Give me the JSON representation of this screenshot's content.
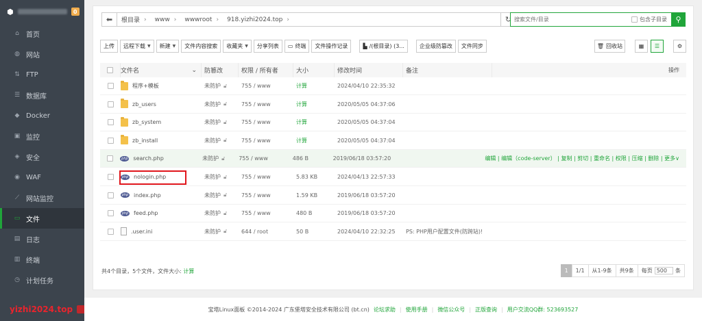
{
  "sidebar": {
    "badge": "0",
    "items": [
      {
        "label": "首页",
        "icon": "home-icon",
        "glyph": "⌂"
      },
      {
        "label": "网站",
        "icon": "globe-icon",
        "glyph": "◍"
      },
      {
        "label": "FTP",
        "icon": "ftp-icon",
        "glyph": "⇅"
      },
      {
        "label": "数据库",
        "icon": "database-icon",
        "glyph": "☰"
      },
      {
        "label": "Docker",
        "icon": "docker-icon",
        "glyph": "◆"
      },
      {
        "label": "监控",
        "icon": "monitor-icon",
        "glyph": "▣"
      },
      {
        "label": "安全",
        "icon": "shield-icon",
        "glyph": "◈"
      },
      {
        "label": "WAF",
        "icon": "waf-icon",
        "glyph": "◉"
      },
      {
        "label": "网站监控",
        "icon": "chart-icon",
        "glyph": "⟋"
      },
      {
        "label": "文件",
        "icon": "folder-icon",
        "glyph": "▭"
      },
      {
        "label": "日志",
        "icon": "log-icon",
        "glyph": "▤"
      },
      {
        "label": "终端",
        "icon": "terminal-icon",
        "glyph": "▥"
      },
      {
        "label": "计划任务",
        "icon": "clock-icon",
        "glyph": "◷"
      }
    ],
    "watermark": "yizhi2024.top"
  },
  "path": {
    "crumbs": [
      "根目录",
      "www",
      "wwwroot",
      "918.yizhi2024.top"
    ]
  },
  "search": {
    "placeholder": "搜索文件/目录",
    "subdir_label": "包含子目录"
  },
  "toolbar": {
    "upload": "上传",
    "remote_download": "远程下载",
    "new": "新建",
    "content_search": "文件内容搜索",
    "favorites": "收藏夹",
    "share_list": "分享列表",
    "terminal": "终端",
    "file_op_log": "文件操作记录",
    "disk": "/(根目录) (3...",
    "enterprise_protect": "企业级防篡改",
    "file_sync": "文件同步",
    "recycle": "回收站"
  },
  "table": {
    "headers": {
      "name": "文件名",
      "protect": "防篡改",
      "perm": "权限 / 所有者",
      "size": "大小",
      "mtime": "修改时间",
      "note": "备注",
      "ops": "操作"
    },
    "rows": [
      {
        "type": "folder",
        "name": "程序+模板",
        "protect": "未防护",
        "perm": "755 / www",
        "size": "计算",
        "mtime": "2024/04/10 22:35:32",
        "note": "",
        "ops": ""
      },
      {
        "type": "folder",
        "name": "zb_users",
        "protect": "未防护",
        "perm": "755 / www",
        "size": "计算",
        "mtime": "2020/05/05 04:37:06",
        "note": "",
        "ops": ""
      },
      {
        "type": "folder",
        "name": "zb_system",
        "protect": "未防护",
        "perm": "755 / www",
        "size": "计算",
        "mtime": "2020/05/05 04:37:04",
        "note": "",
        "ops": ""
      },
      {
        "type": "folder",
        "name": "zb_install",
        "protect": "未防护",
        "perm": "755 / www",
        "size": "计算",
        "mtime": "2020/05/05 04:37:04",
        "note": "",
        "ops": ""
      },
      {
        "type": "php",
        "name": "search.php",
        "protect": "未防护",
        "perm": "755 / www",
        "size": "486 B",
        "mtime": "2019/06/18 03:57:20",
        "note": "",
        "ops": "编辑 | 编辑（code-server） | 复制 | 剪切 | 重命名 | 权限 | 压缩 | 删除 | 更多∨"
      },
      {
        "type": "php",
        "name": "nologin.php",
        "protect": "未防护",
        "perm": "755 / www",
        "size": "5.83 KB",
        "mtime": "2024/04/13 22:57:33",
        "note": "",
        "ops": ""
      },
      {
        "type": "php",
        "name": "index.php",
        "protect": "未防护",
        "perm": "755 / www",
        "size": "1.59 KB",
        "mtime": "2019/06/18 03:57:20",
        "note": "",
        "ops": ""
      },
      {
        "type": "php",
        "name": "feed.php",
        "protect": "未防护",
        "perm": "755 / www",
        "size": "480 B",
        "mtime": "2019/06/18 03:57:20",
        "note": "",
        "ops": ""
      },
      {
        "type": "txt",
        "name": ".user.ini",
        "protect": "未防护",
        "perm": "644 / root",
        "size": "50 B",
        "mtime": "2024/04/10 22:32:25",
        "note": "PS: PHP用户配置文件(防跨站)!",
        "ops": ""
      }
    ]
  },
  "summary": {
    "text": "共4个目录，5个文件，文件大小:",
    "calc": "计算"
  },
  "pager": {
    "current": "1",
    "total_pages": "1/1",
    "range": "从1-9条",
    "total": "共9条",
    "per_page_label": "每页",
    "per_page": "500",
    "unit": "条"
  },
  "footer": {
    "copyright": "宝塔Linux面板 ©2014-2024 广东堡塔安全技术有限公司 (bt.cn)",
    "forum": "论坛求助",
    "manual": "使用手册",
    "wechat": "微信公众号",
    "verify": "正版查询",
    "qq": "用户交流QQ群: 523693527"
  },
  "colors": {
    "accent": "#20a53a",
    "sidebar": "#3c444d",
    "highlight_box": "#e0151b"
  }
}
